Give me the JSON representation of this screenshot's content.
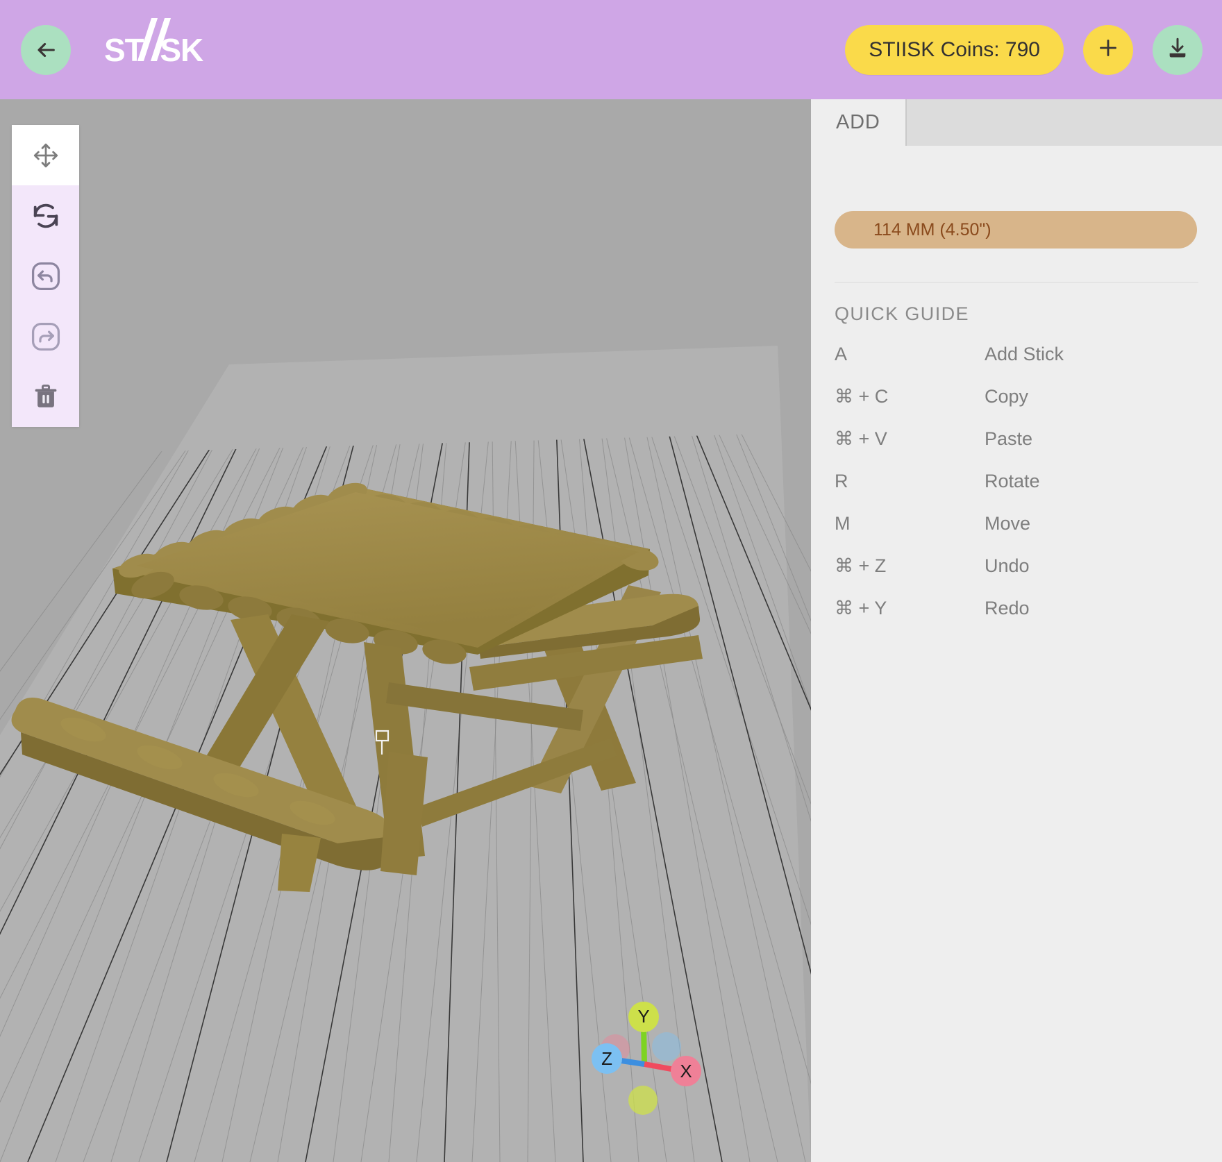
{
  "header": {
    "back_icon": "arrow-left-icon",
    "logo_prefix": "ST",
    "logo_suffix": "SK",
    "logo_full": "STIISK",
    "coins_label": "STIISK Coins: 790",
    "add_icon": "plus-icon",
    "download_icon": "download-icon",
    "colors": {
      "bar": "#cfa6e6",
      "mint": "#abe0c0",
      "yellow": "#fada4a",
      "text_dark": "#3a3535"
    }
  },
  "toolbar": {
    "items": [
      {
        "name": "move-tool",
        "icon": "move-arrows-icon",
        "active": true
      },
      {
        "name": "rotate-tool",
        "icon": "rotate-icon",
        "active": false
      },
      {
        "name": "undo-tool",
        "icon": "undo-box-icon",
        "active": false
      },
      {
        "name": "redo-tool",
        "icon": "redo-box-icon",
        "active": false
      },
      {
        "name": "delete-tool",
        "icon": "trash-icon",
        "active": false
      }
    ]
  },
  "viewport": {
    "background": "#a9a9a9",
    "grid_color": "#8f8f8f",
    "grid_major_color": "#3a3a3a",
    "ground_color": "#b4b4b4",
    "stick_color": "#9a8646",
    "stick_color_light": "#a89352",
    "stick_color_dark": "#80702f",
    "model_name": "picnic-table",
    "cursor_marker": "placement-cursor-icon",
    "gizmo": {
      "name": "axis-gizmo",
      "axes": [
        {
          "label": "Y",
          "color": "#cde04a"
        },
        {
          "label": "X",
          "color": "#ef8097"
        },
        {
          "label": "Z",
          "color": "#7cc0f2"
        }
      ]
    }
  },
  "panel": {
    "tabs": [
      {
        "label": "ADD",
        "active": true
      }
    ],
    "size_pill": {
      "label": "114 MM (4.50\")",
      "bg": "#d8b58a",
      "text": "#8a4a1c"
    },
    "quick_guide": {
      "title": "QUICK GUIDE",
      "rows": [
        {
          "key": "A",
          "action": "Add Stick"
        },
        {
          "key": "⌘ + C",
          "action": "Copy"
        },
        {
          "key": "⌘ + V",
          "action": "Paste"
        },
        {
          "key": "R",
          "action": "Rotate"
        },
        {
          "key": "M",
          "action": "Move"
        },
        {
          "key": "⌘ + Z",
          "action": "Undo"
        },
        {
          "key": "⌘ + Y",
          "action": "Redo"
        }
      ]
    }
  }
}
